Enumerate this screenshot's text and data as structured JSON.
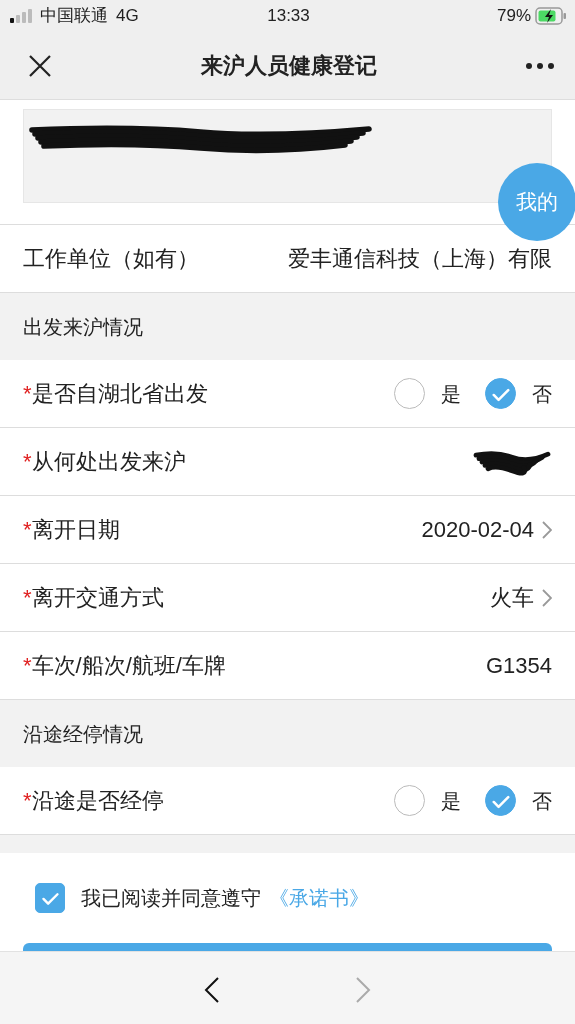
{
  "status_bar": {
    "carrier": "中国联通",
    "network": "4G",
    "time": "13:33",
    "battery": "79%"
  },
  "nav": {
    "title": "来沪人员健康登记"
  },
  "banner": {
    "float_button": "我的"
  },
  "sections": [
    {
      "rows": [
        {
          "kind": "text",
          "label": "工作单位（如有）",
          "value": "爱丰通信科技（上海）有限"
        }
      ]
    },
    {
      "title": "出发来沪情况",
      "rows": [
        {
          "kind": "radio",
          "required_mark": "*",
          "label": "是否自湖北省出发",
          "options": [
            {
              "label": "是",
              "selected": false
            },
            {
              "label": "否",
              "selected": true
            }
          ]
        },
        {
          "kind": "redacted",
          "required_mark": "*",
          "label": "从何处出发来沪"
        },
        {
          "kind": "select",
          "required_mark": "*",
          "label": "离开日期",
          "value": "2020-02-04"
        },
        {
          "kind": "select",
          "required_mark": "*",
          "label": "离开交通方式",
          "value": "火车"
        },
        {
          "kind": "text",
          "required_mark": "*",
          "label": "车次/船次/航班/车牌",
          "value": "G1354"
        }
      ]
    },
    {
      "title": "沿途经停情况",
      "rows": [
        {
          "kind": "radio",
          "required_mark": "*",
          "label": "沿途是否经停",
          "options": [
            {
              "label": "是",
              "selected": false
            },
            {
              "label": "否",
              "selected": true
            }
          ]
        }
      ]
    }
  ],
  "agreement": {
    "checked": true,
    "text": "我已阅读并同意遵守",
    "link": "《承诺书》"
  }
}
